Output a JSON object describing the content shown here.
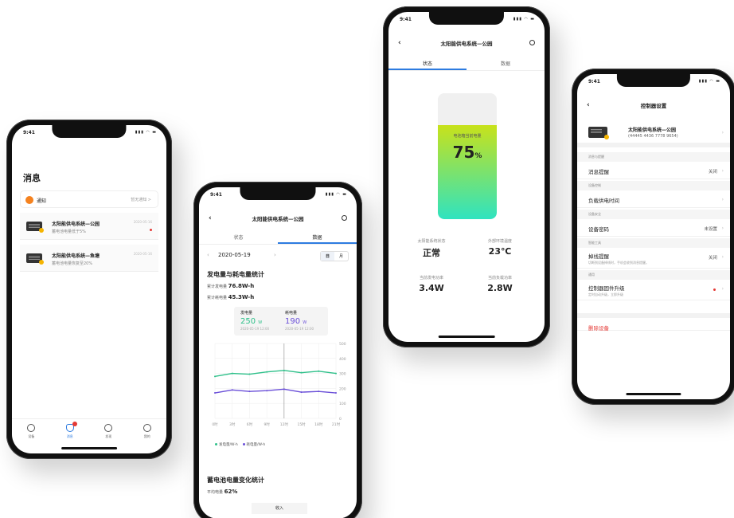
{
  "phone1": {
    "time": "9:41",
    "title": "消息",
    "notice": {
      "label": "通知",
      "action": "暂无通知 >"
    },
    "messages": [
      {
        "title": "太阳能供电系统—公园",
        "subtitle": "蓄电池电量低于5%",
        "date": "2020-05-16"
      },
      {
        "title": "太阳能供电系统—鱼塘",
        "subtitle": "蓄电池电量恢复至20%",
        "date": "2020-05-16"
      }
    ],
    "tabs": [
      "设备",
      "消息",
      "发现",
      "我的"
    ]
  },
  "phone2": {
    "time": "9:41",
    "nav_title": "太阳能供电系统—公园",
    "tabs": [
      "状态",
      "数据"
    ],
    "date": "2020-05-19",
    "range_day": "日",
    "range_month": "月",
    "section1_title": "发电量与耗电量统计",
    "total_gen_label": "累计发电量",
    "total_gen_value": "76.8W-h",
    "total_use_label": "累计耗电量",
    "total_use_value": "45.3W-h",
    "tooltip": {
      "gen_label": "发电量",
      "gen_value": "250",
      "gen_unit": "W",
      "gen_time": "2020-05-19 12:00",
      "use_label": "耗电量",
      "use_value": "190",
      "use_unit": "W",
      "use_time": "2020-05-19 12:00"
    },
    "legend_gen": "发电量/W-h",
    "legend_use": "耗电量/W-h",
    "section2_title": "蓄电池电量变化统计",
    "avg_label": "平均电量",
    "avg_value": "62%",
    "bottom_hint": "收入"
  },
  "chart_data": {
    "type": "line",
    "categories": [
      "0时",
      "3时",
      "6时",
      "9时",
      "12时",
      "15时",
      "18时",
      "21时"
    ],
    "series": [
      {
        "name": "发电量/W-h",
        "color": "#2fc08a",
        "values": [
          280,
          300,
          295,
          310,
          320,
          305,
          315,
          300
        ]
      },
      {
        "name": "耗电量/W-h",
        "color": "#6a4fd8",
        "values": [
          170,
          190,
          180,
          185,
          195,
          175,
          180,
          170
        ]
      }
    ],
    "ylim": [
      0,
      500
    ],
    "yticks": [
      "500",
      "400",
      "300",
      "200",
      "100",
      "0"
    ]
  },
  "phone3": {
    "time": "9:41",
    "nav_title": "太阳能供电系统—公园",
    "tabs": [
      "状态",
      "数据"
    ],
    "battery_label": "电池箱当前电量",
    "battery_value": "75",
    "battery_unit": "%",
    "battery_level": 0.75,
    "colors": {
      "battery_top": "#c8e21a",
      "battery_bottom": "#2fe3c0"
    },
    "stats": [
      {
        "label": "太阳能系统状态",
        "value": "正常"
      },
      {
        "label": "外部环境温度",
        "value": "23℃"
      },
      {
        "label": "当前发电功率",
        "value": "3.4W"
      },
      {
        "label": "当前负载功率",
        "value": "2.8W"
      }
    ]
  },
  "phone4": {
    "time": "9:41",
    "nav_title": "控制器设置",
    "device_name": "太阳能供电系统—公园",
    "device_id": "(44445 4436 7778 9654)",
    "sections": {
      "s1": "消息与提醒",
      "s2": "设备控制",
      "s3": "设备安全",
      "s4": "智能工具",
      "s5": "通用"
    },
    "rows": {
      "msg_reminder": {
        "label": "消息提醒",
        "value": "关闭"
      },
      "load_time": {
        "label": "负载供电时间"
      },
      "password": {
        "label": "设备密码",
        "value": "未设置"
      },
      "disconnect": {
        "label": "掉线提醒",
        "sub": "切断到设备掉线时，手机会收到消息提醒。",
        "value": "关闭"
      },
      "firmware": {
        "label": "控制器固件升级",
        "sub": "定时自动升级，立即升级"
      }
    },
    "delete_label": "删除设备"
  }
}
